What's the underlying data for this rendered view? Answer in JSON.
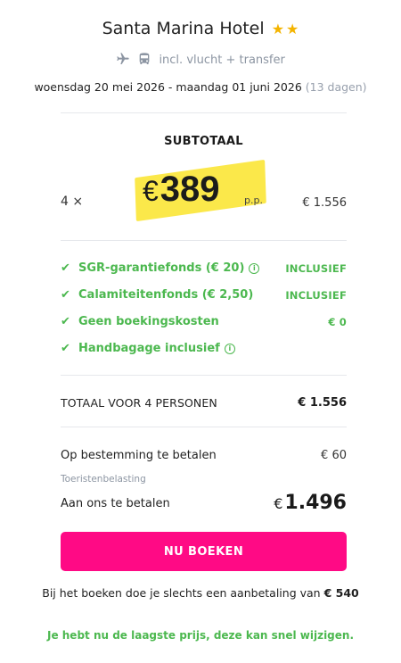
{
  "hotel": {
    "name": "Santa Marina Hotel",
    "stars": 2,
    "transport_text": "incl. vlucht + transfer",
    "icons": [
      "plane-icon",
      "bus-icon"
    ]
  },
  "dates": {
    "range": "woensdag 20 mei 2026 - maandag 01 juni 2026",
    "duration": "(13 dagen)"
  },
  "subtotal": {
    "label": "SUBTOTAAL",
    "quantity": "4 ×",
    "currency": "€",
    "price": "389",
    "per_person": "p.p.",
    "total": "€ 1.556"
  },
  "included": [
    {
      "label": "SGR-garantiefonds (€ 20)",
      "value": "INCLUSIEF",
      "info": true
    },
    {
      "label": "Calamiteitenfonds (€ 2,50)",
      "value": "INCLUSIEF",
      "info": false
    },
    {
      "label": "Geen boekingskosten",
      "value": "€ 0",
      "info": false
    },
    {
      "label": "Handbagage inclusief",
      "value": "",
      "info": true
    }
  ],
  "total": {
    "label": "TOTAAL VOOR 4 PERSONEN",
    "value": "€ 1.556"
  },
  "payment": {
    "destination_label": "Op bestemming te betalen",
    "destination_value": "€ 60",
    "tax_label": "Toeristenbelasting",
    "pay_us_label": "Aan ons te betalen",
    "pay_us_currency": "€",
    "pay_us_value": "1.496"
  },
  "actions": {
    "book_label": "NU BOEKEN"
  },
  "notes": {
    "deposit_prefix": "Bij het boeken doe je slechts een aanbetaling van",
    "deposit_amount": "€ 540",
    "lowest_price": "Je hebt nu de laagste prijs, deze kan snel wijzigen."
  },
  "colors": {
    "accent_pink": "#ff0a85",
    "success_green": "#4cb84f",
    "highlight_yellow": "#fbe84a",
    "star_yellow": "#f4b400"
  }
}
